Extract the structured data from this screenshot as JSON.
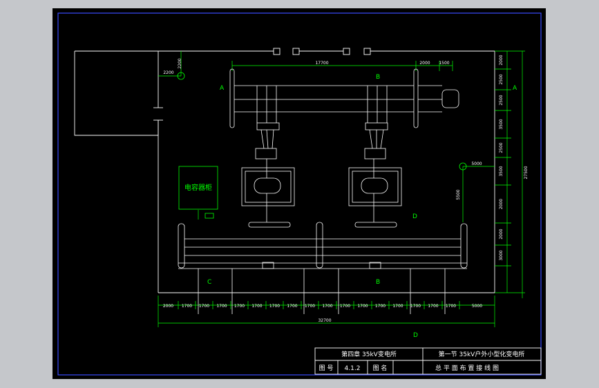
{
  "title_block": {
    "chapter": "第四章 35kV变电所",
    "section": "第一节  35kV户外小型化变电所",
    "fig_no_label": "图 号",
    "fig_no": "4.1.2",
    "fig_name_label": "图 名",
    "fig_name": "总 平 面 布 置 接 线 图"
  },
  "labels": {
    "capacitor_cabinet": "电容器柜",
    "section_A_left": "A",
    "section_A_right": "A",
    "section_B_top": "B",
    "section_B_bottom": "B",
    "section_C": "C",
    "section_D_mid": "D",
    "section_D_bottom": "D"
  },
  "dimensions": {
    "top_span": "17700",
    "top_right_1": "2000",
    "top_right_2": "1500",
    "left_top_v": "2200",
    "left_top_h": "2200",
    "right_mid_h": "5000",
    "right_mid_v": "5500",
    "bottom_segments": [
      "2000",
      "1700",
      "1700",
      "1700",
      "1700",
      "1700",
      "1700",
      "1700",
      "1700",
      "1700",
      "1700",
      "1700",
      "1700",
      "1700",
      "1700",
      "1700",
      "1700",
      "5000"
    ],
    "bottom_total": "32700",
    "right_chain": [
      "2000",
      "2500",
      "2500",
      "3500",
      "2500",
      "3500",
      "2000",
      "2000",
      "3000"
    ],
    "right_total": "27500"
  }
}
